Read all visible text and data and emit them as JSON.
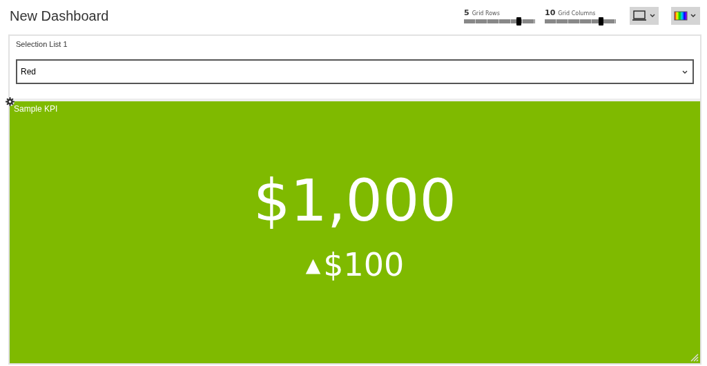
{
  "title": "New Dashboard",
  "sliders": [
    {
      "value": "5",
      "label": "Grid Rows",
      "level": 0.78
    },
    {
      "value": "10",
      "label": "Grid Columns",
      "level": 0.8
    }
  ],
  "selection_list": {
    "title": "Selection List 1",
    "value": "Red"
  },
  "kpi": {
    "title": "Sample KPI",
    "value": "$1,000",
    "change_icon": "▲",
    "change": "$100",
    "color": "#7fba00"
  }
}
